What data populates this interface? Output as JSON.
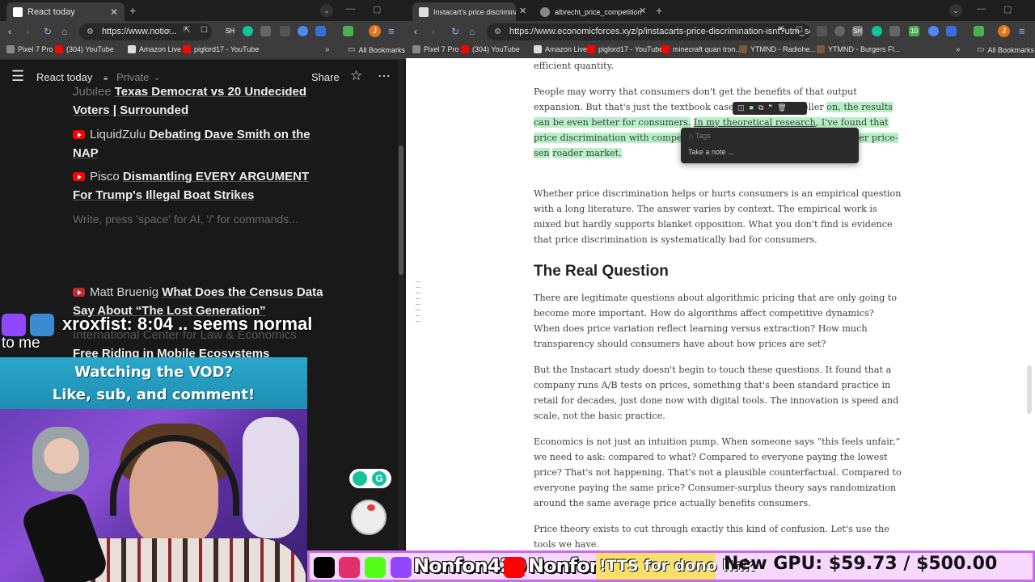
{
  "left_browser": {
    "tab_title": "React today",
    "url": "https://www.notio...",
    "bookmarks": [
      {
        "label": "Pixel 7 Pro"
      },
      {
        "label": "(304) YouTube"
      },
      {
        "label": "Amazon Live"
      },
      {
        "label": "piglord17 - YouTube"
      }
    ],
    "all_bookmarks": "All Bookmarks",
    "notion": {
      "page_title": "React today",
      "privacy": "Private",
      "share": "Share",
      "items": [
        {
          "channel": "Jubilee",
          "title": "Texas Democrat vs 20 Undecided Voters | Surrounded"
        },
        {
          "channel": "LiquidZulu",
          "title": "Debating Dave Smith on the NAP"
        },
        {
          "channel": "Pisco",
          "title": "Dismantling EVERY ARGUMENT For Trump's Illegal Boat Strikes"
        }
      ],
      "placeholder": "Write, press 'space' for AI, '/' for commands...",
      "items2": [
        {
          "channel": "Matt Bruenig",
          "title": "What Does the Census Data Say About “The Lost Generation”"
        },
        {
          "channel": "International Center for Law & Economics",
          "title": "Free Riding in Mobile Ecosystems"
        }
      ]
    }
  },
  "overlay": {
    "chat_user": "xroxfist:",
    "chat_msg": "8:04 .. seems normal",
    "chat_msg2": "to me",
    "vod_line1": "Watching the VOD?",
    "vod_line2": "Like, sub, and comment!"
  },
  "right_browser": {
    "tabs": [
      {
        "title": "Instacart's price discrimination"
      },
      {
        "title": "albrecht_price_competition_co"
      }
    ],
    "url": "https://www.economicforces.xyz/p/instacarts-price-discrimination-isnt?utm_source...",
    "bookmarks": [
      {
        "label": "Pixel 7 Pro"
      },
      {
        "label": "(304) YouTube"
      },
      {
        "label": "Amazon Live"
      },
      {
        "label": "piglord17 - YouTube"
      },
      {
        "label": "minecraft quan tron..."
      },
      {
        "label": "YTMND - Radiohe..."
      },
      {
        "label": "YTMND - Burgers Fl..."
      }
    ],
    "all_bookmarks": "All Bookmarks",
    "article": {
      "frag_top": "efficient quantity.",
      "p1_a": "People may worry that consumers don't get the benefits of that output expansion. But that's just the textbook case with a single seller",
      "p1_hl1": "on, the results can be even better for consumers.",
      "p1_link": "In my theoretical research",
      "p1_hl2": ", I've found that price discrimination with competing fir",
      "p1_hl3": "petition forces firms to fight over price-sen",
      "p1_hl4": "roader market.",
      "p2": "Whether price discrimination helps or hurts consumers is an empirical question with a long literature. The answer varies by context. The empirical work is mixed but hardly supports blanket opposition. What you don't find is evidence that price discrimination is systematically bad for consumers.",
      "h2": "The Real Question",
      "p3": "There are legitimate questions about algorithmic pricing that are only going to become more important. How do algorithms affect competitive dynamics? When does price variation reflect learning versus extraction? How much transparency should consumers have about how prices are set?",
      "p4": "But the Instacart study doesn't begin to touch these questions. It found that a company runs A/B tests on prices, something that's been standard practice in retail for decades, just done now with digital tools. The innovation is speed and scale, not the basic practice.",
      "p5": "Economics is not just an intuition pump. When someone says “this feels unfair,” we need to ask: compared to what? Compared to everyone paying the lowest price? That's not happening. That's not a plausible counterfactual. Compared to everyone paying the same price? Consumer-surplus theory says randomization around the same average price actually benefits consumers.",
      "p6": "Price theory exists to cut through exactly this kind of confusion. Let's use the tools we have."
    },
    "note_popup": {
      "tags": "Tags",
      "placeholder": "Take a note ..."
    }
  },
  "stream_bar": {
    "handle1": "Nonfon420",
    "handle2": "Nonfon",
    "dono": "!TTS for dono link",
    "gpu": "New GPU: $59.73 / $500.00"
  },
  "colors": {
    "highlight": "#b7f0c6",
    "notion_bg": "#191919",
    "chrome_dark": "#3c3c3c"
  }
}
